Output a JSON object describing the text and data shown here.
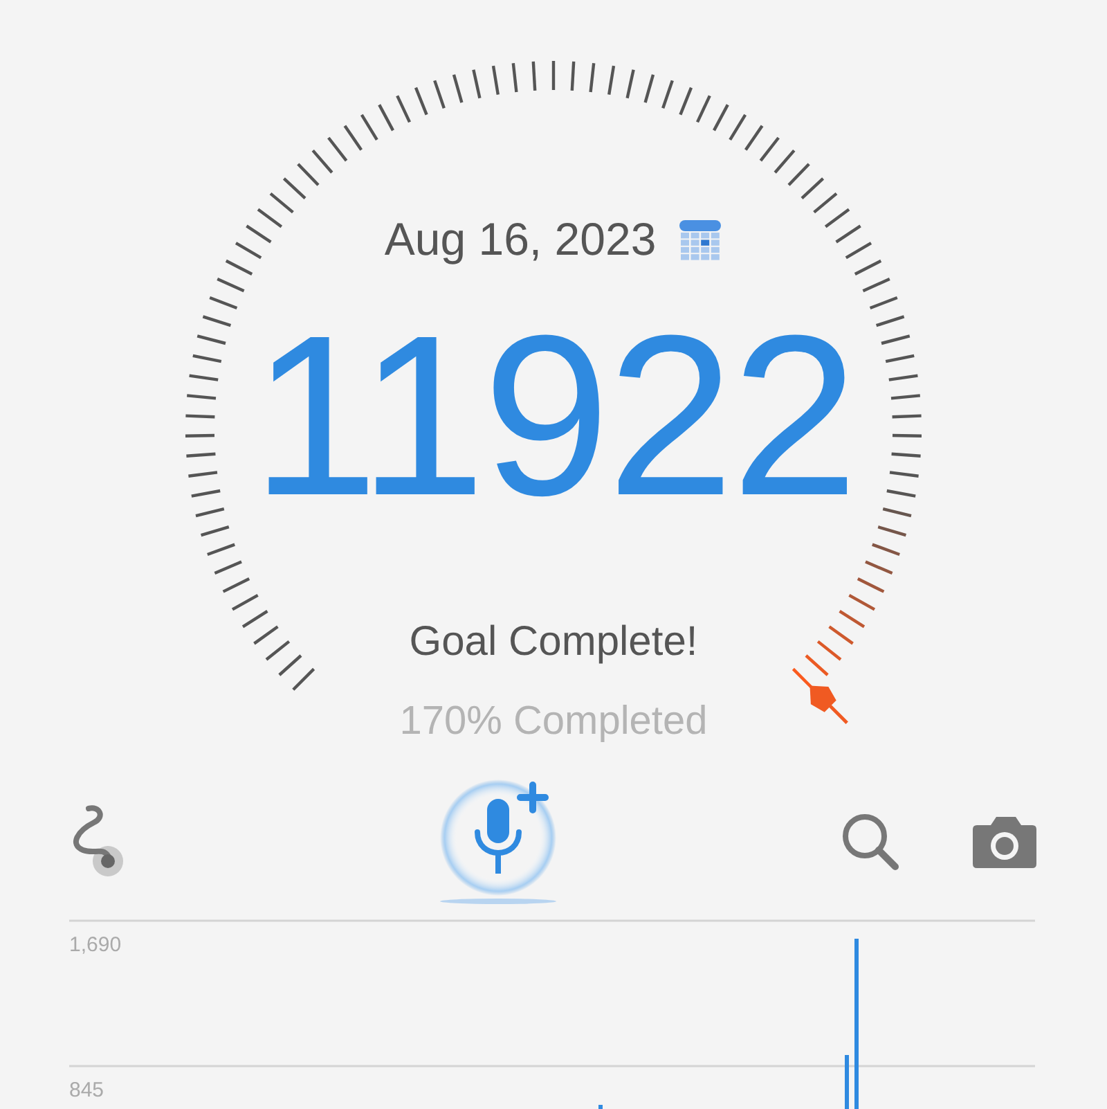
{
  "gauge": {
    "date": "Aug 16, 2023",
    "steps": "11922",
    "status": "Goal Complete!",
    "progress": "170% Completed"
  },
  "toolbar": [
    {
      "kind": "route"
    },
    {
      "kind": "voice-add"
    },
    {
      "kind": "search"
    },
    {
      "kind": "camera"
    }
  ],
  "chart": {
    "y_labels": [
      "1,690",
      "845"
    ]
  }
}
